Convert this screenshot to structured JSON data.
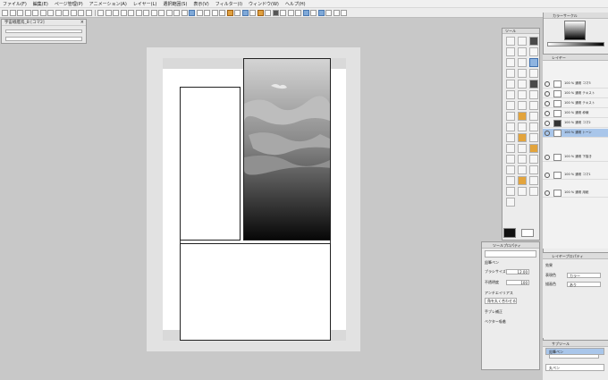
{
  "menu": [
    "ファイル(F)",
    "編集(E)",
    "ページ管理(P)",
    "アニメーション(A)",
    "レイヤー(L)",
    "選択範囲(S)",
    "表示(V)",
    "フィルター(I)",
    "ウィンドウ(W)",
    "ヘルプ(H)"
  ],
  "navigator": {
    "title": "宇宙戦艦鳥_B [コマ2]",
    "close": "×"
  },
  "tool_palette": {
    "title": "ツール"
  },
  "brush": {
    "title": "ツールプロパティ",
    "name": "鉛筆ペン",
    "size_label": "ブラシサイズ",
    "size_value": "12.00",
    "opacity_label": "不透明度",
    "opacity_value": "100",
    "aa_label": "アンチエイリアス",
    "option_label": "角を丸く合わせる",
    "stabilize_label": "手ブレ補正",
    "vector_label": "ベクター吸着"
  },
  "right_panel": {
    "color_title": "カラーサークル",
    "layer_title": "レイヤー",
    "layers": [
      {
        "name": "100 % 通常 コマ3"
      },
      {
        "name": "100 % 通常 テキスト"
      },
      {
        "name": "100 % 通常 テキスト"
      },
      {
        "name": "100 % 通常 枠線"
      },
      {
        "name": "100 % 通常 コマ2",
        "selected": true
      },
      {
        "name": "100 % 通常 トーン"
      },
      {
        "name": "100 % 通常 下描き"
      },
      {
        "name": "100 % 通常 コマ1"
      },
      {
        "name": "100 % 通常 用紙"
      }
    ],
    "prop_title": "レイヤープロパティ",
    "effect_label": "効果",
    "expr_label": "表現色",
    "expr_value": "カラー",
    "fill_label": "描画色",
    "fill_value": "あり",
    "sub_title": "サブツール",
    "sub_items": [
      "鉛筆ペン",
      "丸ペン"
    ]
  }
}
